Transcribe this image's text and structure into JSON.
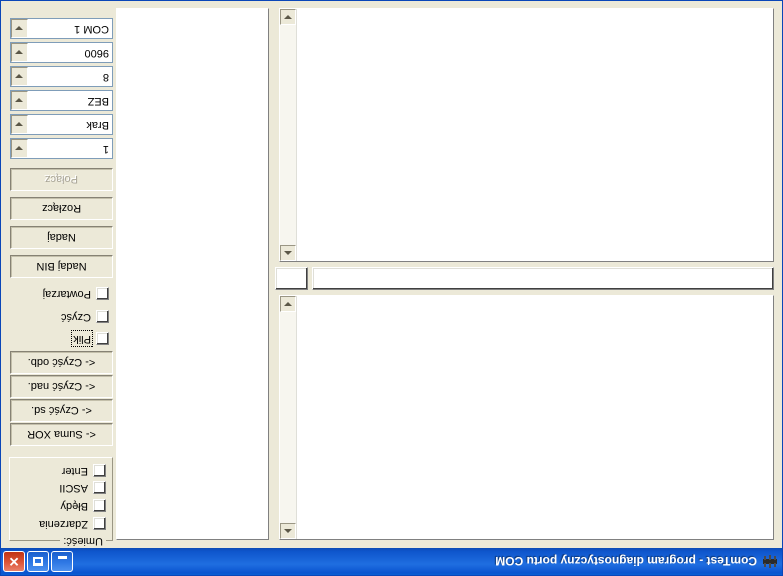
{
  "window": {
    "title": "ComTest - program diagnostyczny portu COM",
    "icon": "serial-port-icon",
    "controls": {
      "minimize": "minimize-icon",
      "maximize": "maximize-icon",
      "close": "close-icon"
    }
  },
  "panels": {
    "receive_memo": {
      "text": "",
      "scroll_up": "scroll-up-arrow",
      "scroll_down": "scroll-down-arrow"
    },
    "send_memo": {
      "text": "",
      "scroll_up": "scroll-up-arrow",
      "scroll_down": "scroll-down-arrow"
    },
    "log_memo": {
      "text": ""
    },
    "send_line_input": {
      "value": "",
      "placeholder": ""
    },
    "checksum_input": {
      "value": "",
      "placeholder": ""
    }
  },
  "settings": {
    "port": "COM 1",
    "baud": "9600",
    "databits": "8",
    "parity": "BEZ",
    "flowcontrol": "Brak",
    "stopbits": "1",
    "dropdown_icon": "chevron-down-icon"
  },
  "actions": {
    "connect": "Połącz",
    "disconnect": "Rozłącz",
    "send": "Nadaj",
    "send_bin": "Nadaj BIN",
    "clear_recv": "<- Czyść odb.",
    "clear_send": "<- Czyść nad.",
    "clear_log": "<- Czyść sd.",
    "xor_sum": "<- Suma XOR"
  },
  "options": [
    {
      "label": "Powtarzaj",
      "checked": false
    },
    {
      "label": "Czyść",
      "checked": false
    },
    {
      "label": "Plik",
      "checked": false,
      "focused": true
    }
  ],
  "include_group": {
    "title": "Umieść:",
    "items": [
      {
        "label": "Zdarzenia",
        "checked": false
      },
      {
        "label": "Błędy",
        "checked": false
      },
      {
        "label": "ASCII",
        "checked": false
      },
      {
        "label": "Enter",
        "checked": false
      }
    ]
  }
}
